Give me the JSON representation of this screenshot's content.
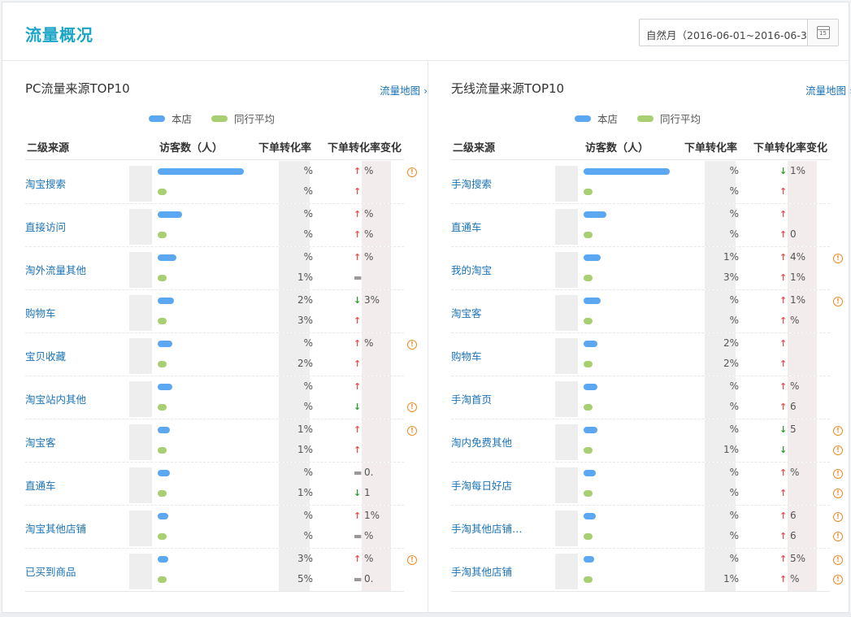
{
  "page_title": "流量概况",
  "date_range": "自然月（2016-06-01~2016-06-30）",
  "colors": {
    "accent": "#1ba5c7",
    "link": "#1b73b7",
    "store_bar": "#5ba7f1",
    "peer_bar": "#a8d072",
    "up": "#e85050",
    "down": "#2a9c2a",
    "warn": "#f08a24"
  },
  "legend": {
    "store": "本店",
    "peer": "同行平均"
  },
  "columns": [
    "二级来源",
    "访客数（人）",
    "下单转化率",
    "下单转化率变化"
  ],
  "panels": [
    {
      "title": "PC流量来源TOP10",
      "link": "流量地图",
      "rows": [
        {
          "source": "淘宝搜索",
          "store_fill": 1.0,
          "peer_fill": 0.1,
          "rate_top": "%",
          "rate_bot": "%",
          "change_top": "%",
          "change_bot": "",
          "dir_top": "up",
          "dir_bot": "up",
          "warn_top": true,
          "warn_bot": false
        },
        {
          "source": "直接访问",
          "store_fill": 0.28,
          "peer_fill": 0.1,
          "rate_top": "%",
          "rate_bot": "%",
          "change_top": "%",
          "change_bot": "%",
          "dir_top": "up",
          "dir_bot": "up",
          "warn_top": false,
          "warn_bot": false
        },
        {
          "source": "淘外流量其他",
          "store_fill": 0.22,
          "peer_fill": 0.1,
          "rate_top": "%",
          "rate_bot": "1%",
          "change_top": "%",
          "change_bot": "",
          "dir_top": "up",
          "dir_bot": "flat",
          "warn_top": false,
          "warn_bot": false
        },
        {
          "source": "购物车",
          "store_fill": 0.19,
          "peer_fill": 0.1,
          "rate_top": "2%",
          "rate_bot": "3%",
          "change_top": "3%",
          "change_bot": "",
          "dir_top": "down",
          "dir_bot": "up",
          "warn_top": false,
          "warn_bot": false
        },
        {
          "source": "宝贝收藏",
          "store_fill": 0.17,
          "peer_fill": 0.1,
          "rate_top": "%",
          "rate_bot": "2%",
          "change_top": "%",
          "change_bot": "",
          "dir_top": "up",
          "dir_bot": "up",
          "warn_top": true,
          "warn_bot": false
        },
        {
          "source": "淘宝站内其他",
          "store_fill": 0.17,
          "peer_fill": 0.1,
          "rate_top": "%",
          "rate_bot": "%",
          "change_top": "",
          "change_bot": "",
          "dir_top": "up",
          "dir_bot": "down",
          "warn_top": false,
          "warn_bot": true
        },
        {
          "source": "淘宝客",
          "store_fill": 0.14,
          "peer_fill": 0.1,
          "rate_top": "1%",
          "rate_bot": "1%",
          "change_top": "",
          "change_bot": "",
          "dir_top": "up",
          "dir_bot": "up",
          "warn_top": true,
          "warn_bot": false
        },
        {
          "source": "直通车",
          "store_fill": 0.14,
          "peer_fill": 0.1,
          "rate_top": "%",
          "rate_bot": "1%",
          "change_top": "0.",
          "change_bot": "1",
          "dir_top": "flat",
          "dir_bot": "down",
          "warn_top": false,
          "warn_bot": false
        },
        {
          "source": "淘宝其他店铺",
          "store_fill": 0.12,
          "peer_fill": 0.1,
          "rate_top": "%",
          "rate_bot": "%",
          "change_top": "1%",
          "change_bot": "%",
          "dir_top": "up",
          "dir_bot": "flat",
          "warn_top": false,
          "warn_bot": false
        },
        {
          "source": "已买到商品",
          "store_fill": 0.12,
          "peer_fill": 0.1,
          "rate_top": "3%",
          "rate_bot": "5%",
          "change_top": "%",
          "change_bot": "0.",
          "dir_top": "up",
          "dir_bot": "flat",
          "warn_top": true,
          "warn_bot": false
        }
      ]
    },
    {
      "title": "无线流量来源TOP10",
      "link": "流量地图",
      "rows": [
        {
          "source": "手淘搜索",
          "store_fill": 1.0,
          "peer_fill": 0.1,
          "rate_top": "%",
          "rate_bot": "%",
          "change_top": "1%",
          "change_bot": "",
          "dir_top": "down",
          "dir_bot": "up",
          "warn_top": false,
          "warn_bot": false
        },
        {
          "source": "直通车",
          "store_fill": 0.26,
          "peer_fill": 0.1,
          "rate_top": "%",
          "rate_bot": "%",
          "change_top": "",
          "change_bot": "0",
          "dir_top": "up",
          "dir_bot": "up",
          "warn_top": false,
          "warn_bot": false
        },
        {
          "source": "我的淘宝",
          "store_fill": 0.2,
          "peer_fill": 0.1,
          "rate_top": "1%",
          "rate_bot": "3%",
          "change_top": "4%",
          "change_bot": "1%",
          "dir_top": "up",
          "dir_bot": "up",
          "warn_top": true,
          "warn_bot": false
        },
        {
          "source": "淘宝客",
          "store_fill": 0.2,
          "peer_fill": 0.1,
          "rate_top": "%",
          "rate_bot": "%",
          "change_top": "1%",
          "change_bot": "%",
          "dir_top": "up",
          "dir_bot": "up",
          "warn_top": true,
          "warn_bot": false
        },
        {
          "source": "购物车",
          "store_fill": 0.16,
          "peer_fill": 0.1,
          "rate_top": "2%",
          "rate_bot": "2%",
          "change_top": "",
          "change_bot": "",
          "dir_top": "up",
          "dir_bot": "up",
          "warn_top": false,
          "warn_bot": false
        },
        {
          "source": "手淘首页",
          "store_fill": 0.16,
          "peer_fill": 0.1,
          "rate_top": "%",
          "rate_bot": "%",
          "change_top": "%",
          "change_bot": "6",
          "dir_top": "up",
          "dir_bot": "up",
          "warn_top": false,
          "warn_bot": false
        },
        {
          "source": "淘内免费其他",
          "store_fill": 0.16,
          "peer_fill": 0.1,
          "rate_top": "%",
          "rate_bot": "1%",
          "change_top": "5",
          "change_bot": "",
          "dir_top": "down",
          "dir_bot": "down",
          "warn_top": true,
          "warn_bot": true
        },
        {
          "source": "手淘每日好店",
          "store_fill": 0.14,
          "peer_fill": 0.1,
          "rate_top": "%",
          "rate_bot": "%",
          "change_top": "%",
          "change_bot": "",
          "dir_top": "up",
          "dir_bot": "up",
          "warn_top": true,
          "warn_bot": true
        },
        {
          "source": "手淘其他店铺…",
          "store_fill": 0.14,
          "peer_fill": 0.1,
          "rate_top": "%",
          "rate_bot": "%",
          "change_top": "6",
          "change_bot": "6",
          "dir_top": "up",
          "dir_bot": "up",
          "warn_top": true,
          "warn_bot": true
        },
        {
          "source": "手淘其他店铺",
          "store_fill": 0.12,
          "peer_fill": 0.1,
          "rate_top": "%",
          "rate_bot": "1%",
          "change_top": "5%",
          "change_bot": "%",
          "dir_top": "up",
          "dir_bot": "up",
          "warn_top": true,
          "warn_bot": true
        }
      ]
    }
  ]
}
